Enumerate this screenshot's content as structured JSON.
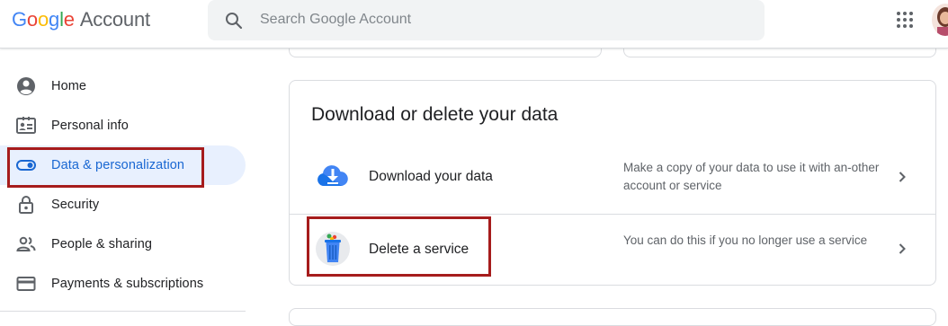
{
  "header": {
    "logo_google": [
      "G",
      "o",
      "o",
      "g",
      "l",
      "e"
    ],
    "logo_account": "Account",
    "search_placeholder": "Search Google Account"
  },
  "sidebar": {
    "items": [
      {
        "label": "Home",
        "icon": "account-circle-icon",
        "active": false
      },
      {
        "label": "Personal info",
        "icon": "id-card-icon",
        "active": false
      },
      {
        "label": "Data & personalization",
        "icon": "toggle-icon",
        "active": true
      },
      {
        "label": "Security",
        "icon": "lock-icon",
        "active": false
      },
      {
        "label": "People & sharing",
        "icon": "people-icon",
        "active": false
      },
      {
        "label": "Payments & subscriptions",
        "icon": "credit-card-icon",
        "active": false
      }
    ]
  },
  "main": {
    "card": {
      "title": "Download or delete your data",
      "rows": [
        {
          "title": "Download your data",
          "description": "Make a copy of your data to use it with an-other account or service",
          "icon": "cloud-download-icon"
        },
        {
          "title": "Delete a service",
          "description": "You can do this if you no longer use a service",
          "icon": "trash-bin-icon"
        }
      ]
    }
  },
  "colors": {
    "accent": "#1967d2",
    "active_bg": "#e8f0fe",
    "highlight": "#a61c1c",
    "border": "#dadce0"
  }
}
